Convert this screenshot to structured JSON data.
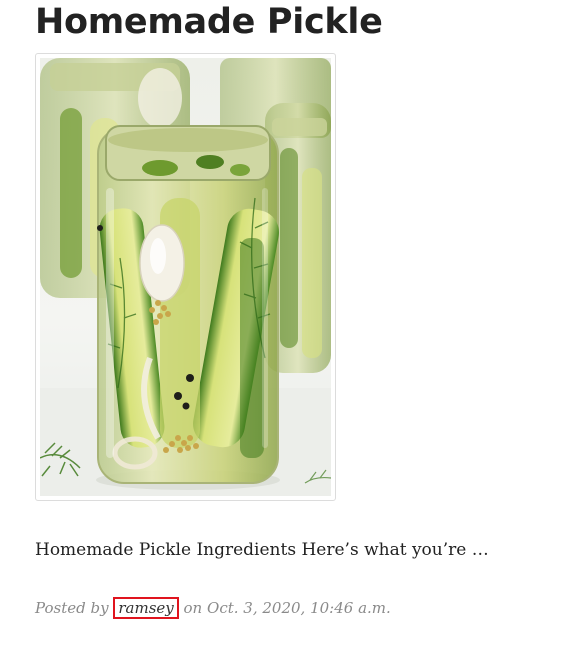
{
  "post": {
    "title": "Homemade Pickle",
    "image_alt": "Jars of homemade pickles with dill and spices",
    "excerpt": "Homemade Pickle Ingredients Here’s what you’re …",
    "meta": {
      "posted_by_label": "Posted by",
      "author": "ramsey",
      "on_label": "on",
      "date": "Oct. 3, 2020, 10:46 a.m."
    }
  },
  "colors": {
    "title": "#222222",
    "meta_text": "#8a8a8a",
    "highlight_box": "#e0141e"
  }
}
